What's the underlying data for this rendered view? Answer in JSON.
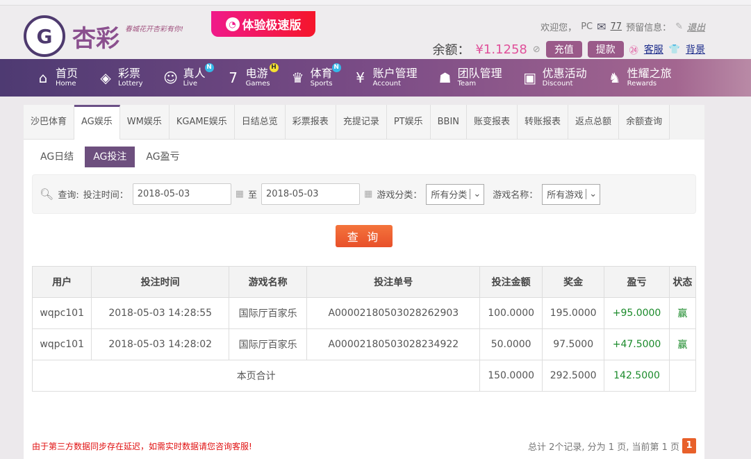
{
  "header": {
    "logo_text": "杏彩",
    "slogan": "春城花开杏彩有你!",
    "speed_label": "体验极速版",
    "welcome": "欢迎您，",
    "user": "PC",
    "mail_count": "77",
    "reserve_label": "预留信息：",
    "logout": "退出",
    "balance_label": "余额：",
    "balance": "¥1.1258",
    "deposit": "充值",
    "withdraw": "提款",
    "service": "客服",
    "background": "背景"
  },
  "nav": [
    {
      "zh": "首页",
      "en": "Home",
      "icon": "⌂"
    },
    {
      "zh": "彩票",
      "en": "Lottery",
      "icon": "◈"
    },
    {
      "zh": "真人",
      "en": "Live",
      "icon": "☺",
      "badge": "N"
    },
    {
      "zh": "电游",
      "en": "Games",
      "icon": "7",
      "badge": "H"
    },
    {
      "zh": "体育",
      "en": "Sports",
      "icon": "♛",
      "badge": "N"
    },
    {
      "zh": "账户管理",
      "en": "Account",
      "icon": "¥"
    },
    {
      "zh": "团队管理",
      "en": "Team",
      "icon": "☗"
    },
    {
      "zh": "优惠活动",
      "en": "Discount",
      "icon": "▣"
    },
    {
      "zh": "性耀之旅",
      "en": "Rewards",
      "icon": "♞"
    }
  ],
  "tabs": [
    "沙巴体育",
    "AG娱乐",
    "WM娱乐",
    "KGAME娱乐",
    "日结总览",
    "彩票报表",
    "充提记录",
    "PT娱乐",
    "BBIN",
    "账变报表",
    "转账报表",
    "返点总额",
    "余额查询"
  ],
  "subtabs": [
    "AG日结",
    "AG投注",
    "AG盈亏"
  ],
  "filter": {
    "query": "查询:",
    "time_label": "投注时间：",
    "start": "2018-05-03",
    "to": "至",
    "end": "2018-05-03",
    "category_label": "游戏分类：",
    "category": "所有分类",
    "game_label": "游戏名称：",
    "game": "所有游戏",
    "button": "查 询"
  },
  "table": {
    "headers": [
      "用户",
      "投注时间",
      "游戏名称",
      "投注单号",
      "投注金额",
      "奖金",
      "盈亏",
      "状态"
    ],
    "rows": [
      [
        "wqpc101",
        "2018-05-03 14:28:55",
        "国际厅百家乐",
        "A00002180503028262903",
        "100.0000",
        "195.0000",
        "+95.0000",
        "赢"
      ],
      [
        "wqpc101",
        "2018-05-03 14:28:02",
        "国际厅百家乐",
        "A00002180503028234922",
        "50.0000",
        "97.5000",
        "+47.5000",
        "赢"
      ]
    ],
    "total": {
      "label": "本页合计",
      "amount": "150.0000",
      "bonus": "292.5000",
      "profit": "142.5000"
    }
  },
  "notice": "由于第三方数据同步存在延迟，如需实时数据请您咨询客服!",
  "pager": {
    "text": "总计 2个记录, 分为 1 页, 当前第 1 页",
    "page": "1"
  }
}
